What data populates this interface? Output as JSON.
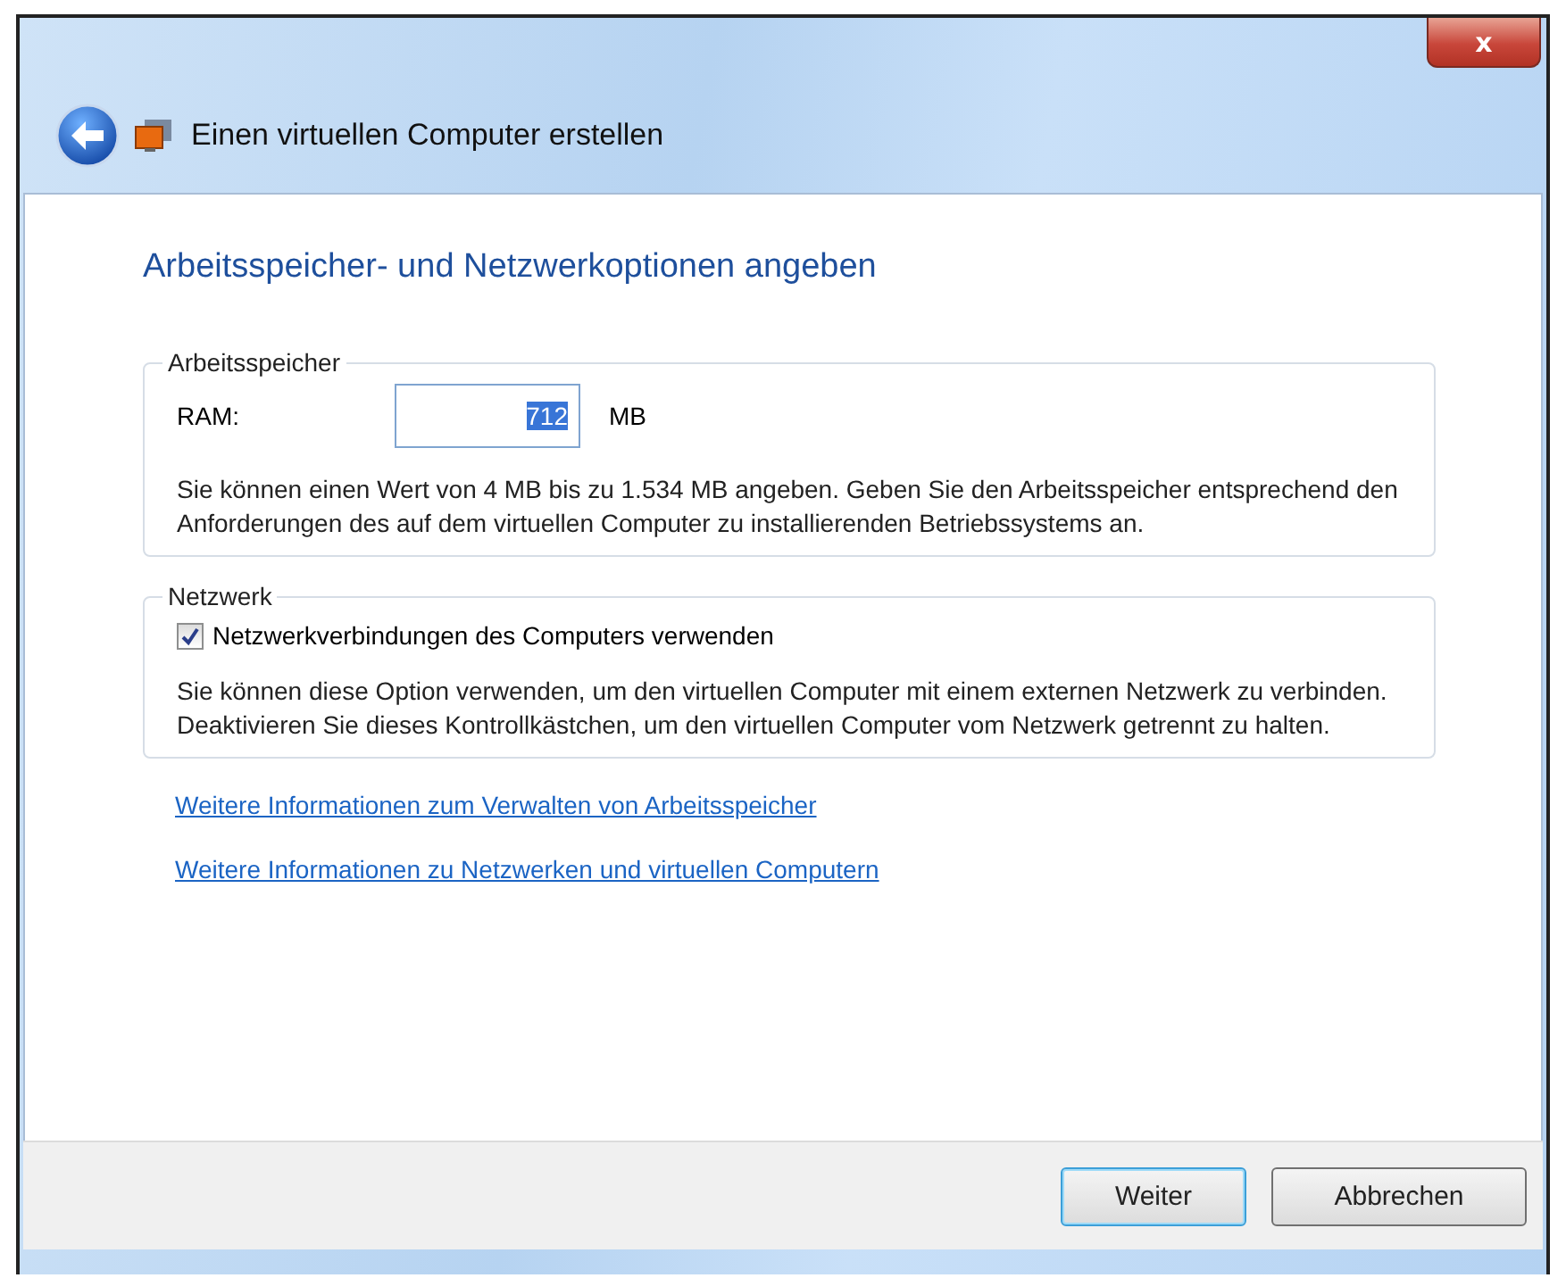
{
  "window": {
    "title": "Einen virtuellen Computer erstellen",
    "close_label": "x"
  },
  "heading": "Arbeitsspeicher- und Netzwerkoptionen angeben",
  "memory_group": {
    "legend": "Arbeitsspeicher",
    "label": "RAM:",
    "value": "712",
    "selected": true,
    "unit": "MB",
    "description": "Sie können einen Wert von 4 MB bis zu 1.534 MB angeben. Geben Sie den Arbeitsspeicher entsprechend den Anforderungen des auf dem virtuellen Computer zu installierenden Betriebssystems an."
  },
  "network_group": {
    "legend": "Netzwerk",
    "checkbox": {
      "label": "Netzwerkverbindungen des Computers verwenden",
      "checked": true
    },
    "description": "Sie können diese Option verwenden, um den virtuellen Computer mit einem externen Netzwerk zu verbinden. Deaktivieren Sie dieses Kontrollkästchen, um den virtuellen Computer vom Netzwerk getrennt zu halten."
  },
  "links": [
    "Weitere Informationen zum Verwalten von Arbeitsspeicher",
    "Weitere Informationen zu Netzwerken und virtuellen Computern"
  ],
  "buttons": [
    {
      "label": "Weiter",
      "selected": true
    },
    {
      "label": "Abbrechen",
      "selected": false
    }
  ]
}
